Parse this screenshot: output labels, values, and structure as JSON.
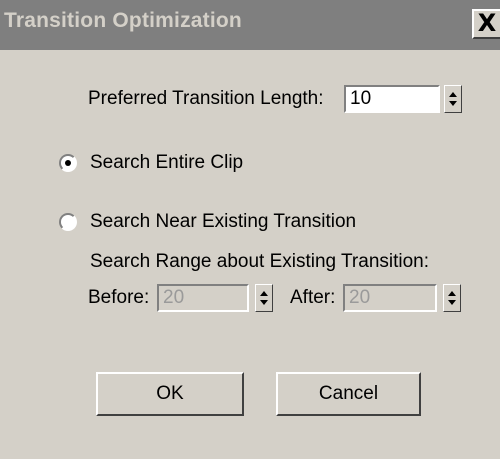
{
  "window": {
    "title": "Transition Optimization",
    "close_label": "X"
  },
  "preferred": {
    "label": "Preferred Transition Length:",
    "value": "10"
  },
  "options": {
    "search_entire": {
      "label": "Search Entire Clip",
      "selected": true
    },
    "search_near": {
      "label": "Search Near Existing Transition",
      "selected": false
    }
  },
  "range": {
    "label": "Search Range about Existing Transition:",
    "before_label": "Before:",
    "before_value": "20",
    "after_label": "After:",
    "after_value": "20"
  },
  "buttons": {
    "ok": "OK",
    "cancel": "Cancel"
  },
  "colors": {
    "dialog_bg": "#d4d0c8",
    "titlebar_bg": "#7f7f7f",
    "titlebar_text": "#d4d0c8",
    "disabled_text": "#9a9a9a"
  }
}
